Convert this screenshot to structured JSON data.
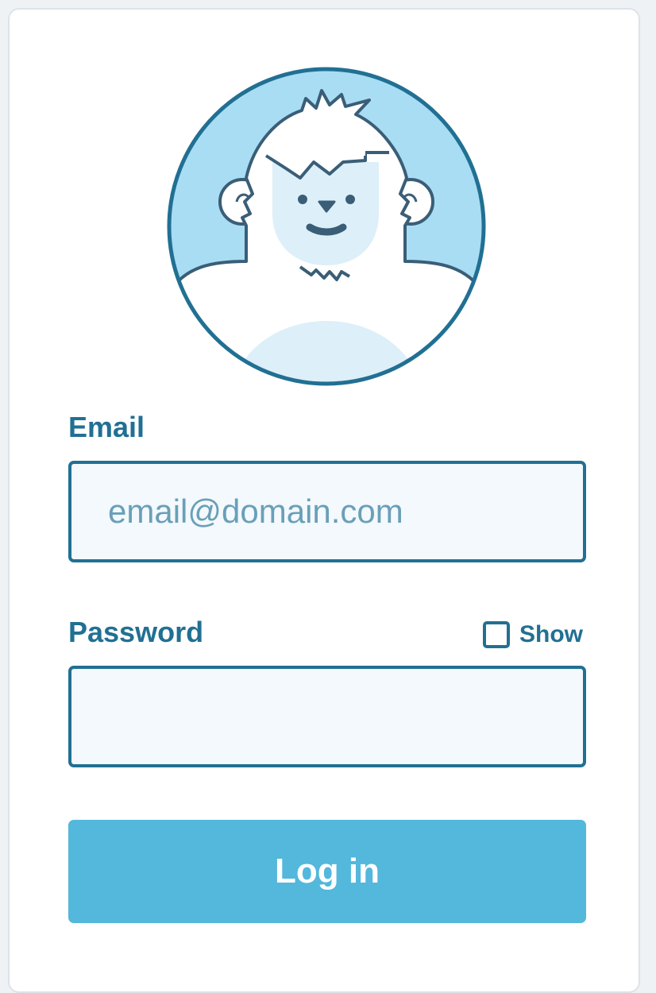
{
  "colors": {
    "brand": "#217093",
    "button": "#53b8db",
    "field_bg": "#f3f9fc",
    "avatar_bg": "#a9ddf3"
  },
  "avatar": {
    "icon": "yeti-avatar-icon"
  },
  "email": {
    "label": "Email",
    "placeholder": "email@domain.com",
    "value": ""
  },
  "password": {
    "label": "Password",
    "value": "",
    "show_label": "Show",
    "show_checked": false
  },
  "login_button": {
    "label": "Log in"
  }
}
